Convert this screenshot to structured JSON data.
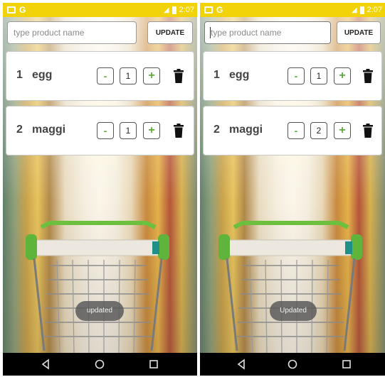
{
  "screens": [
    {
      "status": {
        "time": "2:07"
      },
      "search": {
        "placeholder": "type product name",
        "value": ""
      },
      "update_label": "UPDATE",
      "items": [
        {
          "num": "1",
          "name": "egg",
          "minus": "-",
          "qty": "1",
          "plus": "+"
        },
        {
          "num": "2",
          "name": "maggi",
          "minus": "-",
          "qty": "1",
          "plus": "+"
        }
      ],
      "toast": "updated"
    },
    {
      "status": {
        "time": "2:07"
      },
      "search": {
        "placeholder": "type product name",
        "value": ""
      },
      "update_label": "UPDATE",
      "items": [
        {
          "num": "1",
          "name": "egg",
          "minus": "-",
          "qty": "1",
          "plus": "+"
        },
        {
          "num": "2",
          "name": "maggi",
          "minus": "-",
          "qty": "2",
          "plus": "+"
        }
      ],
      "toast": "Updated"
    }
  ],
  "colors": {
    "statusbar": "#f2d30a",
    "accent_green": "#5bab3a",
    "navbar": "#000000"
  },
  "icons": [
    "image-icon",
    "g-icon",
    "signal-icon",
    "battery-icon",
    "trash-icon",
    "back-icon",
    "home-icon",
    "recent-apps-icon"
  ]
}
